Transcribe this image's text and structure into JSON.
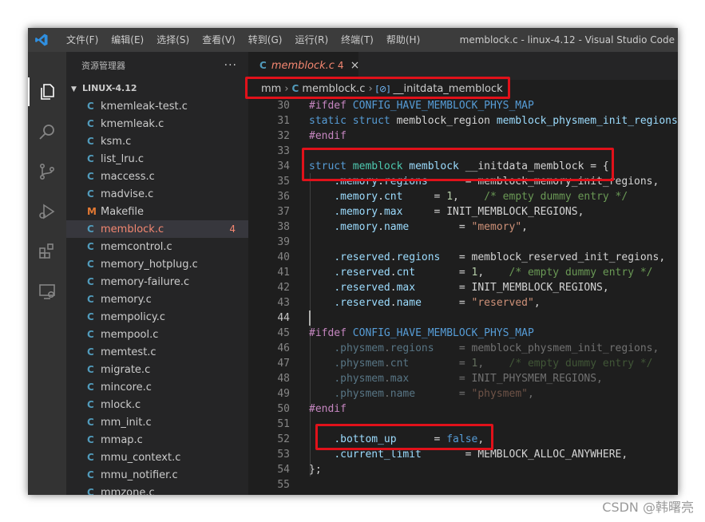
{
  "titlebar": {
    "menu": [
      "文件(F)",
      "编辑(E)",
      "选择(S)",
      "查看(V)",
      "转到(G)",
      "运行(R)",
      "终端(T)",
      "帮助(H)"
    ],
    "window_title": "memblock.c - linux-4.12 - Visual Studio Code"
  },
  "sidebar": {
    "title": "资源管理器",
    "more": "···",
    "folder": "LINUX-4.12",
    "files": [
      {
        "icon": "C",
        "name": "kmemleak-test.c"
      },
      {
        "icon": "C",
        "name": "kmemleak.c"
      },
      {
        "icon": "C",
        "name": "ksm.c"
      },
      {
        "icon": "C",
        "name": "list_lru.c"
      },
      {
        "icon": "C",
        "name": "maccess.c"
      },
      {
        "icon": "C",
        "name": "madvise.c"
      },
      {
        "icon": "M",
        "name": "Makefile"
      },
      {
        "icon": "C",
        "name": "memblock.c",
        "badge": "4",
        "active": true
      },
      {
        "icon": "C",
        "name": "memcontrol.c"
      },
      {
        "icon": "C",
        "name": "memory_hotplug.c"
      },
      {
        "icon": "C",
        "name": "memory-failure.c"
      },
      {
        "icon": "C",
        "name": "memory.c"
      },
      {
        "icon": "C",
        "name": "mempolicy.c"
      },
      {
        "icon": "C",
        "name": "mempool.c"
      },
      {
        "icon": "C",
        "name": "memtest.c"
      },
      {
        "icon": "C",
        "name": "migrate.c"
      },
      {
        "icon": "C",
        "name": "mincore.c"
      },
      {
        "icon": "C",
        "name": "mlock.c"
      },
      {
        "icon": "C",
        "name": "mm_init.c"
      },
      {
        "icon": "C",
        "name": "mmap.c"
      },
      {
        "icon": "C",
        "name": "mmu_context.c"
      },
      {
        "icon": "C",
        "name": "mmu_notifier.c"
      },
      {
        "icon": "C",
        "name": "mmzone.c"
      }
    ]
  },
  "tab": {
    "icon": "C",
    "name": "memblock.c",
    "problems": "4",
    "close": "×"
  },
  "breadcrumb": {
    "folder": "mm",
    "file": "memblock.c",
    "symbol_icon": "[⊘]",
    "symbol": "__initdata_memblock",
    "separator": "›"
  },
  "code": {
    "current_line": 44,
    "lines": [
      {
        "n": "30",
        "t": [
          [
            "pp",
            "#ifdef "
          ],
          [
            "mac",
            "CONFIG_HAVE_MEMBLOCK_PHYS_MAP"
          ]
        ]
      },
      {
        "n": "31",
        "t": [
          [
            "kw",
            "static "
          ],
          [
            "kw",
            "struct "
          ],
          [
            "pl",
            "memblock_region "
          ],
          [
            "id",
            "memblock_physmem_init_regions"
          ],
          [
            "pl",
            "["
          ]
        ]
      },
      {
        "n": "32",
        "t": [
          [
            "pp",
            "#endif"
          ]
        ]
      },
      {
        "n": "33",
        "t": []
      },
      {
        "n": "34",
        "t": [
          [
            "kw",
            "struct "
          ],
          [
            "ty",
            "memblock "
          ],
          [
            "id",
            "memblock "
          ],
          [
            "pl",
            "__initdata_memblock = {"
          ]
        ]
      },
      {
        "n": "35",
        "t": [
          [
            "pl",
            "    "
          ],
          [
            "id",
            "."
          ],
          [
            "id",
            "memory"
          ],
          [
            "pl",
            "."
          ],
          [
            "id",
            "regions"
          ],
          [
            "pl",
            "      = memblock_memory_init_regions,"
          ]
        ]
      },
      {
        "n": "36",
        "t": [
          [
            "pl",
            "    "
          ],
          [
            "id",
            ".memory"
          ],
          [
            "pl",
            "."
          ],
          [
            "id",
            "cnt"
          ],
          [
            "pl",
            "     = "
          ],
          [
            "num",
            "1"
          ],
          [
            "pl",
            ",    "
          ],
          [
            "cmt",
            "/* empty dummy entry */"
          ]
        ]
      },
      {
        "n": "37",
        "t": [
          [
            "pl",
            "    "
          ],
          [
            "id",
            ".memory"
          ],
          [
            "pl",
            "."
          ],
          [
            "id",
            "max"
          ],
          [
            "pl",
            "     = INIT_MEMBLOCK_REGIONS,"
          ]
        ]
      },
      {
        "n": "38",
        "t": [
          [
            "pl",
            "    "
          ],
          [
            "id",
            ".memory"
          ],
          [
            "pl",
            "."
          ],
          [
            "id",
            "name"
          ],
          [
            "pl",
            "        = "
          ],
          [
            "str",
            "\"memory\""
          ],
          [
            "pl",
            ","
          ]
        ]
      },
      {
        "n": "39",
        "t": []
      },
      {
        "n": "40",
        "t": [
          [
            "pl",
            "    "
          ],
          [
            "id",
            ".reserved"
          ],
          [
            "pl",
            "."
          ],
          [
            "id",
            "regions"
          ],
          [
            "pl",
            "   = memblock_reserved_init_regions,"
          ]
        ]
      },
      {
        "n": "41",
        "t": [
          [
            "pl",
            "    "
          ],
          [
            "id",
            ".reserved"
          ],
          [
            "pl",
            "."
          ],
          [
            "id",
            "cnt"
          ],
          [
            "pl",
            "       = "
          ],
          [
            "num",
            "1"
          ],
          [
            "pl",
            ",    "
          ],
          [
            "cmt",
            "/* empty dummy entry */"
          ]
        ]
      },
      {
        "n": "42",
        "t": [
          [
            "pl",
            "    "
          ],
          [
            "id",
            ".reserved"
          ],
          [
            "pl",
            "."
          ],
          [
            "id",
            "max"
          ],
          [
            "pl",
            "       = INIT_MEMBLOCK_REGIONS,"
          ]
        ]
      },
      {
        "n": "43",
        "t": [
          [
            "pl",
            "    "
          ],
          [
            "id",
            ".reserved"
          ],
          [
            "pl",
            "."
          ],
          [
            "id",
            "name"
          ],
          [
            "pl",
            "      = "
          ],
          [
            "str",
            "\"reserved\""
          ],
          [
            "pl",
            ","
          ]
        ]
      },
      {
        "n": "44",
        "t": []
      },
      {
        "n": "45",
        "t": [
          [
            "pp",
            "#ifdef "
          ],
          [
            "mac",
            "CONFIG_HAVE_MEMBLOCK_PHYS_MAP"
          ]
        ]
      },
      {
        "n": "46",
        "t": [
          [
            "pl",
            "    "
          ],
          [
            "id",
            ".physmem"
          ],
          [
            "pl",
            "."
          ],
          [
            "id",
            "regions"
          ],
          [
            "pl",
            "    = memblock_physmem_init_regions,"
          ]
        ],
        "dim": true
      },
      {
        "n": "47",
        "t": [
          [
            "pl",
            "    "
          ],
          [
            "id",
            ".physmem"
          ],
          [
            "pl",
            "."
          ],
          [
            "id",
            "cnt"
          ],
          [
            "pl",
            "        = "
          ],
          [
            "num",
            "1"
          ],
          [
            "pl",
            ",    "
          ],
          [
            "cmt",
            "/* empty dummy entry */"
          ]
        ],
        "dim": true
      },
      {
        "n": "48",
        "t": [
          [
            "pl",
            "    "
          ],
          [
            "id",
            ".physmem"
          ],
          [
            "pl",
            "."
          ],
          [
            "id",
            "max"
          ],
          [
            "pl",
            "        = INIT_PHYSMEM_REGIONS,"
          ]
        ],
        "dim": true
      },
      {
        "n": "49",
        "t": [
          [
            "pl",
            "    "
          ],
          [
            "id",
            ".physmem"
          ],
          [
            "pl",
            "."
          ],
          [
            "id",
            "name"
          ],
          [
            "pl",
            "       = "
          ],
          [
            "str",
            "\"physmem\""
          ],
          [
            "pl",
            ","
          ]
        ],
        "dim": true
      },
      {
        "n": "50",
        "t": [
          [
            "pp",
            "#endif"
          ]
        ]
      },
      {
        "n": "51",
        "t": []
      },
      {
        "n": "52",
        "t": [
          [
            "pl",
            "    "
          ],
          [
            "id",
            ".bottom_up"
          ],
          [
            "pl",
            "      = "
          ],
          [
            "kw",
            "false"
          ],
          [
            "pl",
            ","
          ]
        ]
      },
      {
        "n": "53",
        "t": [
          [
            "pl",
            "    "
          ],
          [
            "id",
            ".current_limit"
          ],
          [
            "pl",
            "       = MEMBLOCK_ALLOC_ANYWHERE,"
          ]
        ]
      },
      {
        "n": "54",
        "t": [
          [
            "pl",
            "};"
          ]
        ]
      },
      {
        "n": "55",
        "t": []
      }
    ]
  },
  "watermark": "CSDN @韩曙亮",
  "colors": {
    "highlight_box": "#e1111a",
    "accent": "#007acc",
    "problem": "#f48771"
  }
}
